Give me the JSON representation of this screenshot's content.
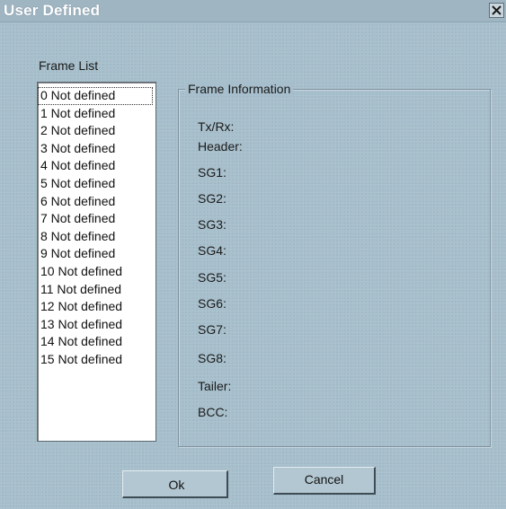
{
  "window": {
    "title": "User Defined",
    "close_icon": "close-x-icon"
  },
  "frame_list": {
    "label": "Frame List",
    "selected_index": 0,
    "items": [
      "0 Not defined",
      "1 Not defined",
      "2 Not defined",
      "3 Not defined",
      "4 Not defined",
      "5 Not defined",
      "6 Not defined",
      "7 Not defined",
      "8 Not defined",
      "9 Not defined",
      "10 Not defined",
      "11 Not defined",
      "12 Not defined",
      "13 Not defined",
      "14 Not defined",
      "15 Not defined"
    ]
  },
  "frame_information": {
    "legend": "Frame Information",
    "fields": [
      "Tx/Rx:",
      "Header:",
      "SG1:",
      "SG2:",
      "SG3:",
      "SG4:",
      "SG5:",
      "SG6:",
      "SG7:",
      "SG8:",
      "Tailer:",
      "BCC:"
    ]
  },
  "buttons": {
    "ok_label": "Ok",
    "cancel_label": "Cancel"
  },
  "colors": {
    "dialog_background": "#a7bfcc",
    "title_text": "#ffffff",
    "list_background": "#ffffff"
  }
}
